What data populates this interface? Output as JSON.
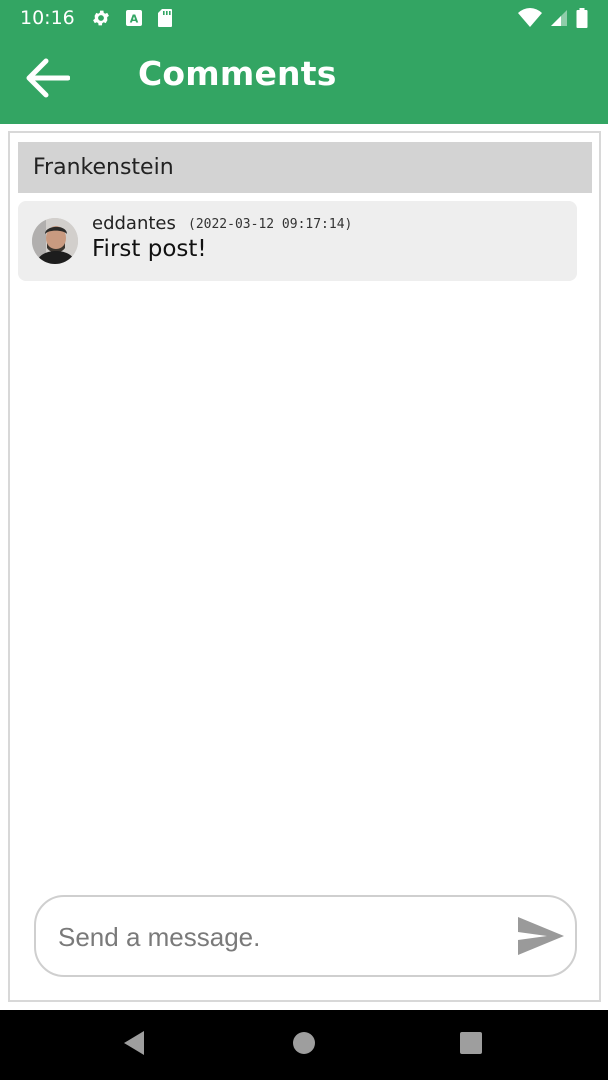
{
  "status_bar": {
    "time": "10:16",
    "left_icons": [
      "gear-icon",
      "font-a-icon",
      "sd-card-icon"
    ],
    "right_icons": [
      "wifi-icon",
      "cell-signal-icon",
      "battery-icon"
    ]
  },
  "app_bar": {
    "title": "Comments",
    "back_icon": "arrow-left-icon"
  },
  "book": {
    "title": "Frankenstein"
  },
  "comments": [
    {
      "user": "eddantes",
      "timestamp": "(2022-03-12 09:17:14)",
      "text": "First post!"
    }
  ],
  "composer": {
    "placeholder": "Send a message.",
    "send_icon": "send-icon"
  },
  "nav_bar": {
    "buttons": [
      "back-triangle-icon",
      "home-circle-icon",
      "recents-square-icon"
    ]
  },
  "colors": {
    "primary": "#33a563",
    "header_bg": "#d3d3d3",
    "comment_bg": "#eeeeee"
  }
}
